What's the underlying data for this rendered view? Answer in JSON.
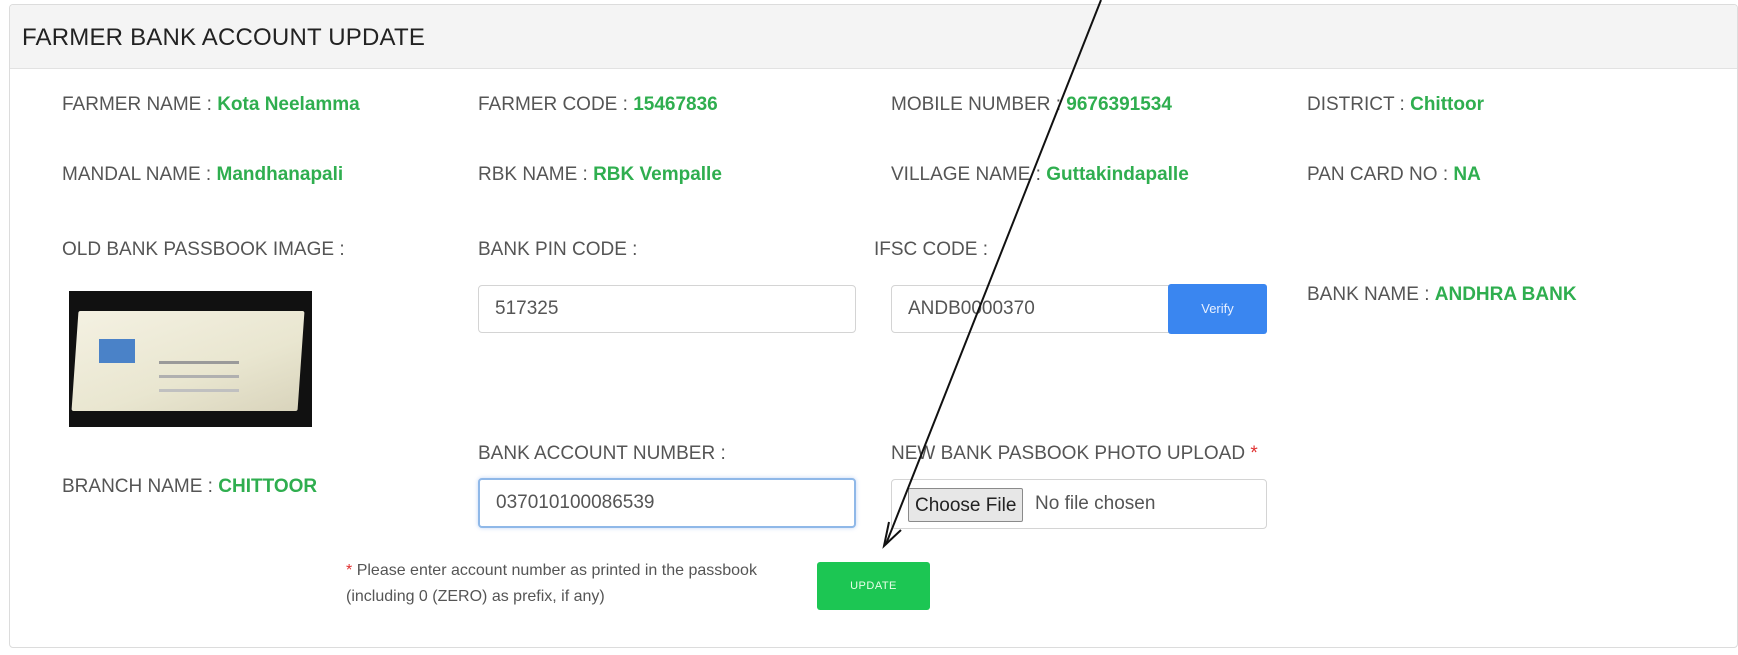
{
  "header": {
    "title": "FARMER BANK ACCOUNT UPDATE"
  },
  "details": {
    "farmer_name": {
      "label": "FARMER NAME : ",
      "value": "Kota Neelamma"
    },
    "farmer_code": {
      "label": "FARMER CODE : ",
      "value": "15467836"
    },
    "mobile_number": {
      "label": "MOBILE NUMBER : ",
      "value": "9676391534"
    },
    "district": {
      "label": "DISTRICT : ",
      "value": "Chittoor"
    },
    "mandal_name": {
      "label": "MANDAL NAME : ",
      "value": "Mandhanapali"
    },
    "rbk_name": {
      "label": "RBK NAME : ",
      "value": "RBK Vempalle"
    },
    "village_name": {
      "label": "VILLAGE NAME : ",
      "value": "Guttakindapalle"
    },
    "pan_card": {
      "label": "PAN CARD NO : ",
      "value": "NA"
    },
    "bank_name": {
      "label": "BANK NAME : ",
      "value": "ANDHRA BANK"
    },
    "branch_name": {
      "label": "BRANCH NAME : ",
      "value": "CHITTOOR"
    }
  },
  "form": {
    "old_passbook_label": "OLD BANK PASSBOOK IMAGE :",
    "bank_pin_label": "BANK PIN CODE :",
    "bank_pin_value": "517325",
    "ifsc_label": "IFSC CODE :",
    "ifsc_value": "ANDB0000370",
    "verify_label": "Verify",
    "account_label": "BANK ACCOUNT NUMBER :",
    "account_value": "037010100086539",
    "upload_label": "NEW BANK PASBOOK PHOTO UPLOAD",
    "upload_required": "*",
    "choose_file_label": "Choose File",
    "no_file_text": "No file chosen",
    "note_star": "*",
    "note_text": "Please enter account number as printed in the passbook (including 0 (ZERO) as prefix, if any)",
    "update_label": "UPDATE"
  },
  "icons": {
    "passbook_thumbnail": "passbook-photo",
    "annotation": "arrow-annotation"
  },
  "colors": {
    "value_green": "#2fae4f",
    "verify_blue": "#3a86f0",
    "update_green": "#1cc653",
    "required_red": "#e03030"
  }
}
